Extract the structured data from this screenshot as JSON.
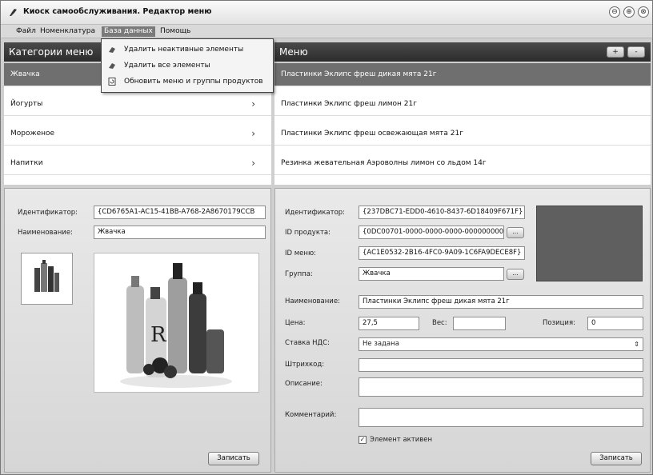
{
  "window": {
    "title": "Киоск самообслуживания. Редактор меню",
    "controls": [
      "⊖",
      "⊕",
      "⊗"
    ]
  },
  "menubar": {
    "items": [
      "Файл",
      "Номенклатура",
      "База данных",
      "Помощь"
    ]
  },
  "dropdown": {
    "items": [
      "Удалить неактивные элементы",
      "Удалить все элементы",
      "Обновить меню и группы продуктов"
    ]
  },
  "categories": {
    "title": "Категории меню",
    "items": [
      "Жвачка",
      "Йогурты",
      "Мороженое",
      "Напитки"
    ],
    "chevron": "›"
  },
  "menu": {
    "title": "Меню",
    "add_label": "+",
    "remove_label": "-",
    "items": [
      "Пластинки Эклипс фреш дикая мята 21г",
      "Пластинки Эклипс фреш лимон 21г",
      "Пластинки Эклипс фреш освежающая мята 21г",
      "Резинка жевательная Аэроволны лимон со льдом 14г"
    ]
  },
  "category_form": {
    "id_label": "Идентификатор:",
    "id_value": "{CD6765A1-AC15-41BB-A768-2A8670179CCB",
    "name_label": "Наименование:",
    "name_value": "Жвачка",
    "save_label": "Записать"
  },
  "item_form": {
    "id_label": "Идентификатор:",
    "id_value": "{237DBC71-EDD0-4610-8437-6D18409F671F}",
    "product_id_label": "ID продукта:",
    "product_id_value": "{0DC00701-0000-0000-0000-000000000(",
    "menu_id_label": "ID меню:",
    "menu_id_value": "{AC1E0532-2B16-4FC0-9A09-1C6FA9DECE8F}",
    "group_label": "Группа:",
    "group_value": "Жвачка",
    "name_label": "Наименование:",
    "name_value": "Пластинки Эклипс фреш дикая мята 21г",
    "price_label": "Цена:",
    "price_value": "27,5",
    "weight_label": "Вес:",
    "weight_value": "",
    "position_label": "Позиция:",
    "position_value": "0",
    "vat_label": "Ставка НДС:",
    "vat_value": "Не задана",
    "barcode_label": "Штрихкод:",
    "description_label": "Описание:",
    "comment_label": "Комментарий:",
    "active_label": "Элемент активен",
    "save_label": "Записать",
    "dots_label": "..."
  },
  "colors": {
    "header_dark": "#2c2c2c",
    "selected_row": "#6f6f6f",
    "active_menu": "#7a7a7a"
  }
}
